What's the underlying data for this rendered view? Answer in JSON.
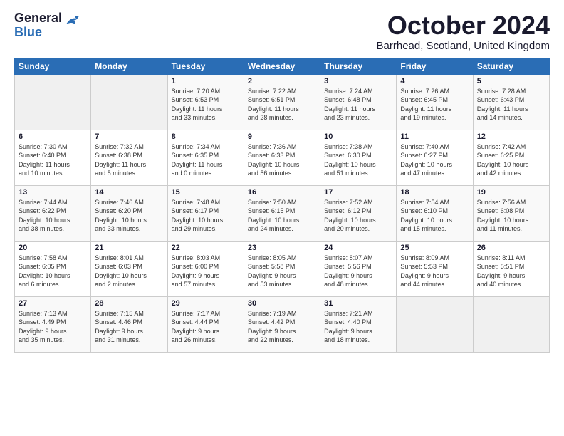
{
  "logo": {
    "line1": "General",
    "line2": "Blue"
  },
  "title": "October 2024",
  "subtitle": "Barrhead, Scotland, United Kingdom",
  "headers": [
    "Sunday",
    "Monday",
    "Tuesday",
    "Wednesday",
    "Thursday",
    "Friday",
    "Saturday"
  ],
  "weeks": [
    [
      {
        "day": "",
        "info": ""
      },
      {
        "day": "",
        "info": ""
      },
      {
        "day": "1",
        "info": "Sunrise: 7:20 AM\nSunset: 6:53 PM\nDaylight: 11 hours\nand 33 minutes."
      },
      {
        "day": "2",
        "info": "Sunrise: 7:22 AM\nSunset: 6:51 PM\nDaylight: 11 hours\nand 28 minutes."
      },
      {
        "day": "3",
        "info": "Sunrise: 7:24 AM\nSunset: 6:48 PM\nDaylight: 11 hours\nand 23 minutes."
      },
      {
        "day": "4",
        "info": "Sunrise: 7:26 AM\nSunset: 6:45 PM\nDaylight: 11 hours\nand 19 minutes."
      },
      {
        "day": "5",
        "info": "Sunrise: 7:28 AM\nSunset: 6:43 PM\nDaylight: 11 hours\nand 14 minutes."
      }
    ],
    [
      {
        "day": "6",
        "info": "Sunrise: 7:30 AM\nSunset: 6:40 PM\nDaylight: 11 hours\nand 10 minutes."
      },
      {
        "day": "7",
        "info": "Sunrise: 7:32 AM\nSunset: 6:38 PM\nDaylight: 11 hours\nand 5 minutes."
      },
      {
        "day": "8",
        "info": "Sunrise: 7:34 AM\nSunset: 6:35 PM\nDaylight: 11 hours\nand 0 minutes."
      },
      {
        "day": "9",
        "info": "Sunrise: 7:36 AM\nSunset: 6:33 PM\nDaylight: 10 hours\nand 56 minutes."
      },
      {
        "day": "10",
        "info": "Sunrise: 7:38 AM\nSunset: 6:30 PM\nDaylight: 10 hours\nand 51 minutes."
      },
      {
        "day": "11",
        "info": "Sunrise: 7:40 AM\nSunset: 6:27 PM\nDaylight: 10 hours\nand 47 minutes."
      },
      {
        "day": "12",
        "info": "Sunrise: 7:42 AM\nSunset: 6:25 PM\nDaylight: 10 hours\nand 42 minutes."
      }
    ],
    [
      {
        "day": "13",
        "info": "Sunrise: 7:44 AM\nSunset: 6:22 PM\nDaylight: 10 hours\nand 38 minutes."
      },
      {
        "day": "14",
        "info": "Sunrise: 7:46 AM\nSunset: 6:20 PM\nDaylight: 10 hours\nand 33 minutes."
      },
      {
        "day": "15",
        "info": "Sunrise: 7:48 AM\nSunset: 6:17 PM\nDaylight: 10 hours\nand 29 minutes."
      },
      {
        "day": "16",
        "info": "Sunrise: 7:50 AM\nSunset: 6:15 PM\nDaylight: 10 hours\nand 24 minutes."
      },
      {
        "day": "17",
        "info": "Sunrise: 7:52 AM\nSunset: 6:12 PM\nDaylight: 10 hours\nand 20 minutes."
      },
      {
        "day": "18",
        "info": "Sunrise: 7:54 AM\nSunset: 6:10 PM\nDaylight: 10 hours\nand 15 minutes."
      },
      {
        "day": "19",
        "info": "Sunrise: 7:56 AM\nSunset: 6:08 PM\nDaylight: 10 hours\nand 11 minutes."
      }
    ],
    [
      {
        "day": "20",
        "info": "Sunrise: 7:58 AM\nSunset: 6:05 PM\nDaylight: 10 hours\nand 6 minutes."
      },
      {
        "day": "21",
        "info": "Sunrise: 8:01 AM\nSunset: 6:03 PM\nDaylight: 10 hours\nand 2 minutes."
      },
      {
        "day": "22",
        "info": "Sunrise: 8:03 AM\nSunset: 6:00 PM\nDaylight: 9 hours\nand 57 minutes."
      },
      {
        "day": "23",
        "info": "Sunrise: 8:05 AM\nSunset: 5:58 PM\nDaylight: 9 hours\nand 53 minutes."
      },
      {
        "day": "24",
        "info": "Sunrise: 8:07 AM\nSunset: 5:56 PM\nDaylight: 9 hours\nand 48 minutes."
      },
      {
        "day": "25",
        "info": "Sunrise: 8:09 AM\nSunset: 5:53 PM\nDaylight: 9 hours\nand 44 minutes."
      },
      {
        "day": "26",
        "info": "Sunrise: 8:11 AM\nSunset: 5:51 PM\nDaylight: 9 hours\nand 40 minutes."
      }
    ],
    [
      {
        "day": "27",
        "info": "Sunrise: 7:13 AM\nSunset: 4:49 PM\nDaylight: 9 hours\nand 35 minutes."
      },
      {
        "day": "28",
        "info": "Sunrise: 7:15 AM\nSunset: 4:46 PM\nDaylight: 9 hours\nand 31 minutes."
      },
      {
        "day": "29",
        "info": "Sunrise: 7:17 AM\nSunset: 4:44 PM\nDaylight: 9 hours\nand 26 minutes."
      },
      {
        "day": "30",
        "info": "Sunrise: 7:19 AM\nSunset: 4:42 PM\nDaylight: 9 hours\nand 22 minutes."
      },
      {
        "day": "31",
        "info": "Sunrise: 7:21 AM\nSunset: 4:40 PM\nDaylight: 9 hours\nand 18 minutes."
      },
      {
        "day": "",
        "info": ""
      },
      {
        "day": "",
        "info": ""
      }
    ]
  ]
}
